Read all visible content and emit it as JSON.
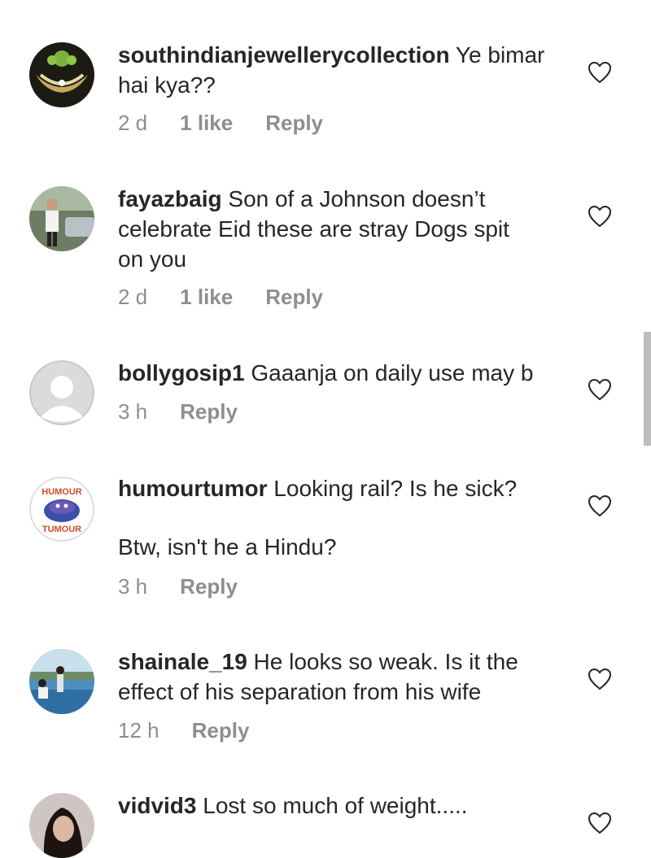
{
  "comments": [
    {
      "username": "southindianjewellerycollection",
      "line1": " Ye bimar",
      "line2": "hai kya??",
      "time": "2 d",
      "likes": "1 like",
      "reply": "Reply"
    },
    {
      "username": "fayazbaig",
      "line1": " Son of a Johnson doesn’t",
      "line2": "celebrate Eid these are stray Dogs spit",
      "line3": "on you",
      "time": "2 d",
      "likes": "1 like",
      "reply": "Reply"
    },
    {
      "username": "bollygosip1",
      "line1": " Gaaanja on daily use may b",
      "time": "3 h",
      "reply": "Reply"
    },
    {
      "username": "humourtumor",
      "line1": " Looking rail? Is he sick?",
      "line2": "Btw, isn't he a Hindu?",
      "avatar_text_top": "HUMOUR",
      "avatar_text_bottom": "TUMOUR",
      "time": "3 h",
      "reply": "Reply"
    },
    {
      "username": "shainale_19",
      "line1": " He looks so weak. Is it the",
      "line2": "effect of his separation from his wife",
      "time": "12 h",
      "reply": "Reply"
    },
    {
      "username": "vidvid3",
      "line1": " Lost so much of weight....."
    }
  ],
  "icons": {
    "like": "heart-outline-icon"
  },
  "colors": {
    "text": "#262626",
    "meta": "#8e8e8e"
  }
}
